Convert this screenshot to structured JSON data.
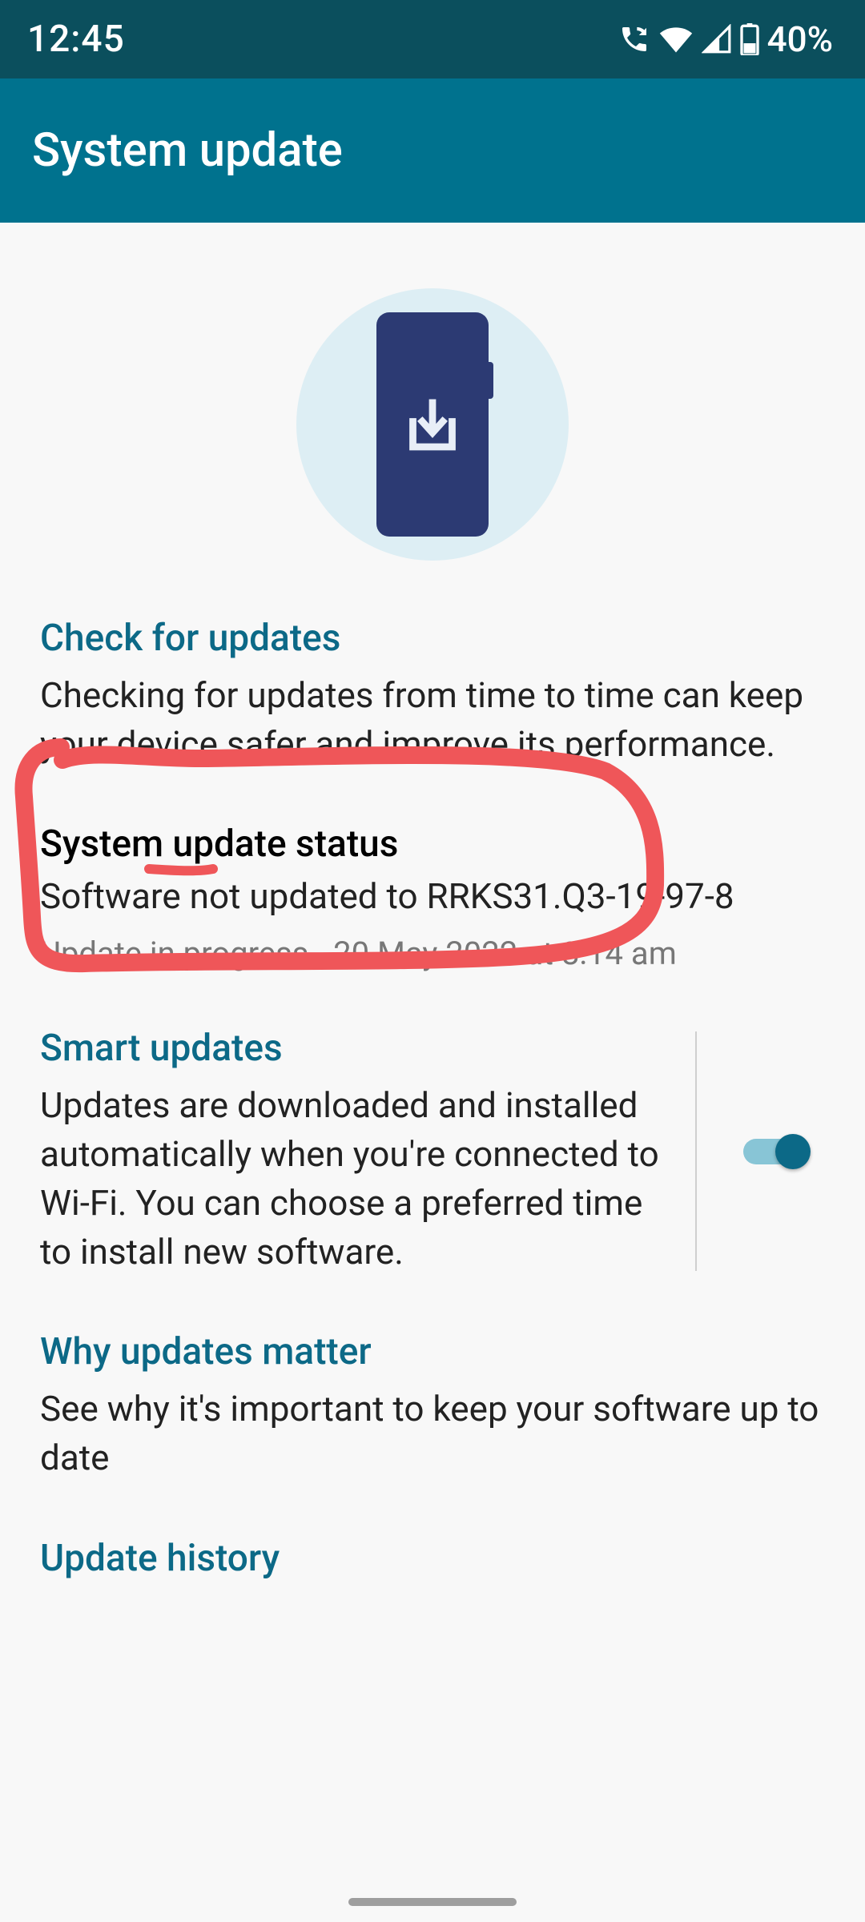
{
  "status_bar": {
    "time": "12:45",
    "battery_text": "40%"
  },
  "app_bar": {
    "title": "System update"
  },
  "sections": {
    "check": {
      "title": "Check for updates",
      "body": "Checking for updates from time to time can keep your device safer and improve its performance."
    },
    "status": {
      "title": "System update status",
      "line": "Software not updated to RRKS31.Q3-19-97-8",
      "sub": "Update in progress - 20 May 2022 at 8:14 am"
    },
    "smart": {
      "title": "Smart updates",
      "body": "Updates are downloaded and installed automatically when you're connected to Wi-Fi. You can choose a preferred time to install new software.",
      "toggle_on": true
    },
    "why": {
      "title": "Why updates matter",
      "body": "See why it's important to keep your software up to date"
    },
    "history": {
      "title": "Update history"
    }
  }
}
